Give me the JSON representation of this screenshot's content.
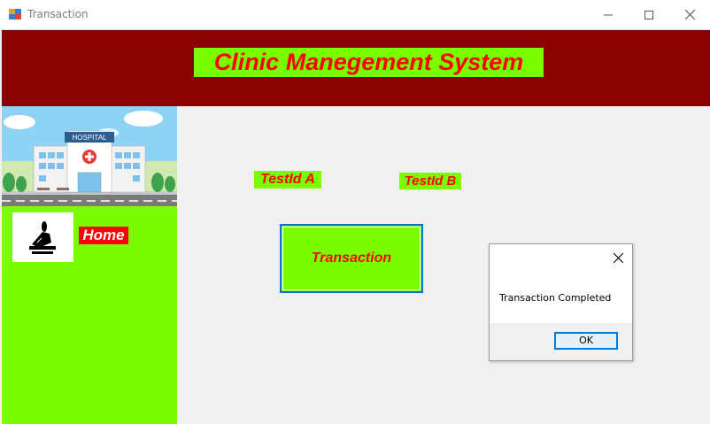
{
  "window": {
    "title": "Transaction",
    "minimize_icon": "minimize-icon",
    "maximize_icon": "maximize-icon",
    "close_icon": "close-icon"
  },
  "header": {
    "title": "Clinic Manegement System",
    "background_color": "#8b0000",
    "title_background": "#7cfc00",
    "title_color": "#ff0000"
  },
  "sidebar": {
    "background_color": "#7cfc00",
    "banner_image": "hospital-illustration",
    "banner_sign": "HOSPITAL",
    "home_icon": "home-icon",
    "home_label": "Home"
  },
  "main": {
    "label_a": "TestId A",
    "label_b": "TestId B",
    "transaction_button": "Transaction"
  },
  "dialog": {
    "message": "Transaction Completed",
    "ok_button": "OK",
    "close_icon": "close-icon"
  }
}
